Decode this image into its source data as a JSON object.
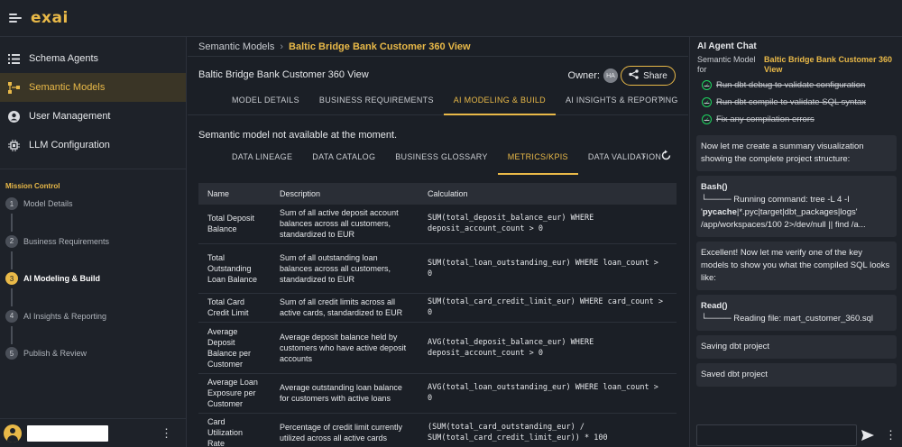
{
  "app": {
    "logo": "exai"
  },
  "sidebar": {
    "items": [
      {
        "label": "Schema Agents",
        "icon": "list-icon"
      },
      {
        "label": "Semantic Models",
        "icon": "nodes-icon",
        "active": true
      },
      {
        "label": "User Management",
        "icon": "user-circle-icon"
      },
      {
        "label": "LLM Configuration",
        "icon": "chip-icon"
      }
    ],
    "mission_title": "Mission Control",
    "steps": [
      {
        "num": "1",
        "label": "Model Details"
      },
      {
        "num": "2",
        "label": "Business Requirements"
      },
      {
        "num": "3",
        "label": "AI Modeling & Build",
        "active": true
      },
      {
        "num": "4",
        "label": "AI Insights & Reporting"
      },
      {
        "num": "5",
        "label": "Publish & Review"
      }
    ]
  },
  "breadcrumb": {
    "root": "Semantic Models",
    "sep": "›",
    "current": "Baltic Bridge Bank Customer 360 View"
  },
  "header": {
    "title": "Baltic Bridge Bank Customer 360 View",
    "owner_label": "Owner:",
    "owner_initials": "HA",
    "share_label": "Share"
  },
  "tabs": [
    "MODEL DETAILS",
    "BUSINESS REQUIREMENTS",
    "AI MODELING & BUILD",
    "AI INSIGHTS & REPORTING"
  ],
  "active_tab": 2,
  "status_text": "Semantic model not available at the moment.",
  "subtabs": [
    "DATA LINEAGE",
    "DATA CATALOG",
    "BUSINESS GLOSSARY",
    "METRICS/KPIS",
    "DATA VALIDATION"
  ],
  "active_subtab": 3,
  "table": {
    "headers": [
      "Name",
      "Description",
      "Calculation"
    ],
    "rows": [
      [
        "Total Deposit Balance",
        "Sum of all active deposit account balances across all customers, standardized to EUR",
        "SUM(total_deposit_balance_eur) WHERE deposit_account_count > 0"
      ],
      [
        "Total Outstanding Loan Balance",
        "Sum of all outstanding loan balances across all customers, standardized to EUR",
        "SUM(total_loan_outstanding_eur) WHERE loan_count > 0"
      ],
      [
        "Total Card Credit Limit",
        "Sum of all credit limits across all active cards, standardized to EUR",
        "SUM(total_card_credit_limit_eur) WHERE card_count > 0"
      ],
      [
        "Average Deposit Balance per Customer",
        "Average deposit balance held by customers who have active deposit accounts",
        "AVG(total_deposit_balance_eur) WHERE deposit_account_count > 0"
      ],
      [
        "Average Loan Exposure per Customer",
        "Average outstanding loan balance for customers with active loans",
        "AVG(total_loan_outstanding_eur) WHERE loan_count > 0"
      ],
      [
        "Card Utilization Rate",
        "Percentage of credit limit currently utilized across all active cards",
        "(SUM(total_card_outstanding_eur) / SUM(total_card_credit_limit_eur)) * 100"
      ]
    ]
  },
  "chat": {
    "title": "AI Agent Chat",
    "sub_key": "Semantic Model for",
    "sub_value": "Baltic Bridge Bank Customer 360 View",
    "checks": [
      "Run dbt debug to validate configuration",
      "Run dbt compile to validate SQL syntax",
      "Fix any compilation errors"
    ],
    "messages": [
      {
        "text": "Now let me create a summary visualization showing the complete project structure:"
      },
      {
        "tool": "Bash()",
        "detail": "└──── Running command: tree -L 4 -I",
        "detail2_pre": "'",
        "detail2_bold": "pycache",
        "detail2_post": "|*.pyc|target|dbt_packages|logs' /app/workspaces/100 2>/dev/null || find /a..."
      },
      {
        "text": "Excellent! Now let me verify one of the key models to show you what the compiled SQL looks like:"
      },
      {
        "tool": "Read()",
        "detail": "└──── Reading file: mart_customer_360.sql"
      },
      {
        "text": "Saving dbt project"
      },
      {
        "text": "Saved dbt project"
      }
    ]
  }
}
